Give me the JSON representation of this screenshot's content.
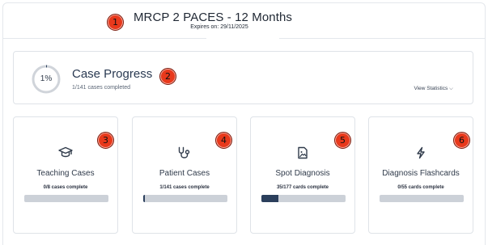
{
  "header": {
    "title": "MRCP 2 PACES - 12 Months",
    "expires": "Expires on: 29/11/2025"
  },
  "annotations": [
    "1",
    "2",
    "3",
    "4",
    "5",
    "6"
  ],
  "progress": {
    "percent_label": "1%",
    "percent_value": 0.01,
    "title": "Case Progress",
    "subtitle": "1/141 cases completed",
    "view_statistics": "View Statistics ⌵"
  },
  "cards": [
    {
      "icon": "graduation-cap-icon",
      "title": "Teaching Cases",
      "subtitle": "0/8 cases complete",
      "progress": 0.0
    },
    {
      "icon": "stethoscope-icon",
      "title": "Patient Cases",
      "subtitle": "1/141 cases complete",
      "progress": 0.007
    },
    {
      "icon": "image-file-icon",
      "title": "Spot Diagnosis",
      "subtitle": "35/177 cards complete",
      "progress": 0.198
    },
    {
      "icon": "lightning-icon",
      "title": "Diagnosis Flashcards",
      "subtitle": "0/55 cards complete",
      "progress": 0.0
    }
  ],
  "colors": {
    "badge": "#e8391c",
    "progress_fill": "#2b3f5c",
    "progress_track": "#ccd1d8",
    "ring_track": "#d0d4da",
    "ring_fill": "#2b3f5c"
  }
}
